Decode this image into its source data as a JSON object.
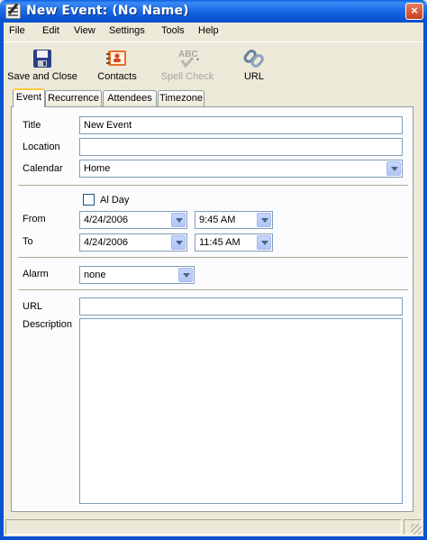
{
  "window": {
    "title": "New Event: (No Name)",
    "close_glyph": "×"
  },
  "menubar": [
    "File",
    "Edit",
    "View",
    "Settings",
    "Tools",
    "Help"
  ],
  "toolbar": {
    "save_close": {
      "label": "Save and Close",
      "icon": "floppy-disk-icon"
    },
    "contacts": {
      "label": "Contacts",
      "icon": "address-book-icon"
    },
    "spell_check": {
      "label": "Spell Check",
      "icon": "spell-check-icon",
      "icon_text": "ABC",
      "enabled": false
    },
    "url": {
      "label": "URL",
      "icon": "chain-link-icon"
    }
  },
  "tabs": [
    "Event",
    "Recurrence",
    "Attendees",
    "Timezone"
  ],
  "active_tab": "Event",
  "form": {
    "title_label": "Title",
    "title_value": "New Event",
    "location_label": "Location",
    "location_value": "",
    "calendar_label": "Calendar",
    "calendar_value": "Home",
    "allday_label": "Al Day",
    "allday_checked": false,
    "from_label": "From",
    "from_date": "4/24/2006",
    "from_time": "9:45 AM",
    "to_label": "To",
    "to_date": "4/24/2006",
    "to_time": "11:45 AM",
    "alarm_label": "Alarm",
    "alarm_value": "none",
    "url_label": "URL",
    "url_value": "",
    "description_label": "Description",
    "description_value": ""
  },
  "colors": {
    "titlebar": "#0b55d6",
    "face": "#ece9d8",
    "tab_highlight": "#ffc83c",
    "field_border": "#7f9db9"
  }
}
